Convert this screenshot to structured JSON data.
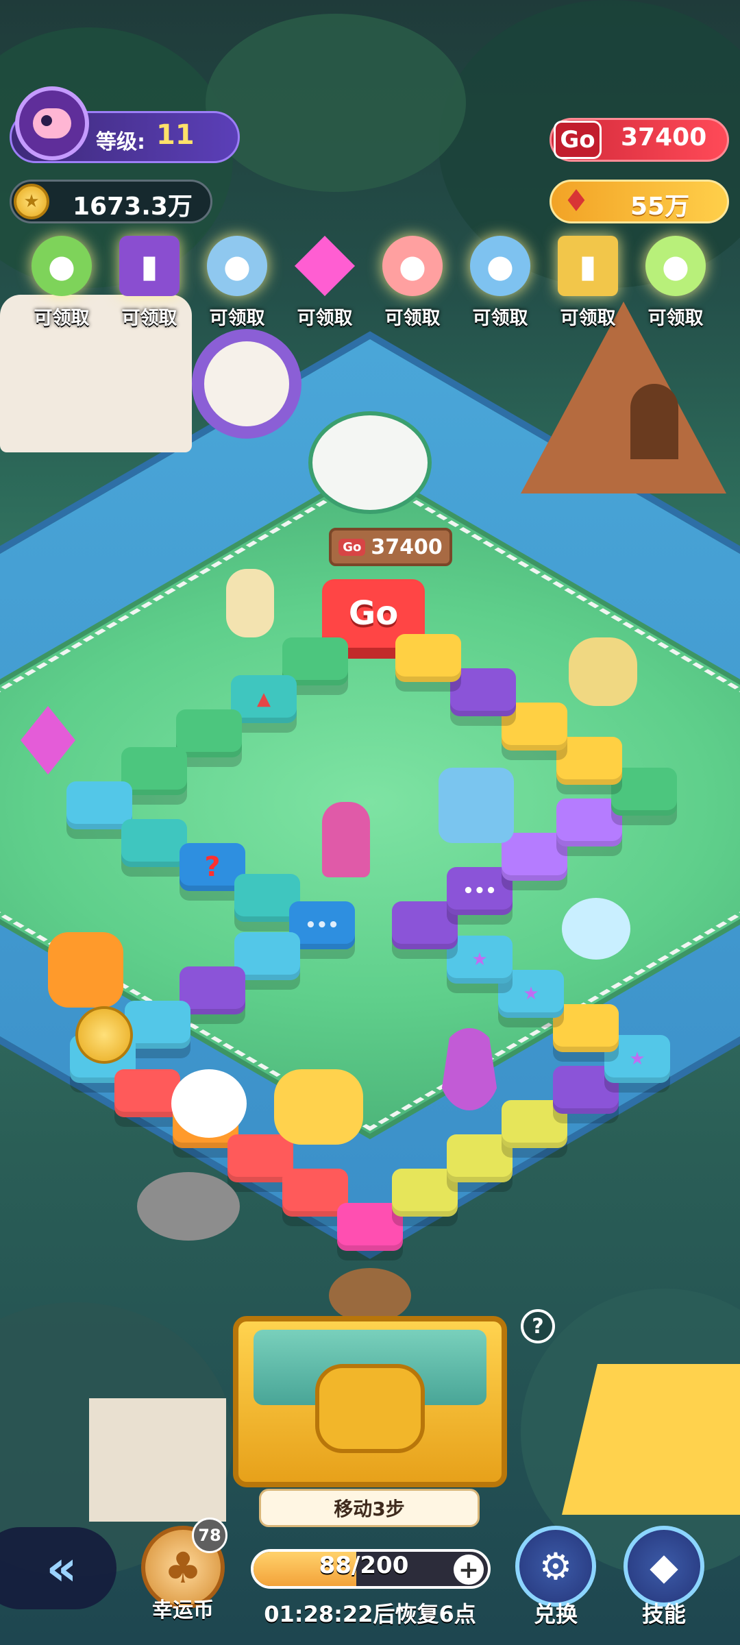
{
  "hud": {
    "level_label": "等级:",
    "level_value": "11",
    "coins": "1673.3万",
    "go_points": "37400",
    "go_badge": "Go",
    "gems": "55万"
  },
  "rewards": [
    {
      "label": "可领取",
      "icon": "green-fish-icon"
    },
    {
      "label": "可领取",
      "icon": "purple-book-icon"
    },
    {
      "label": "可领取",
      "icon": "parrot-icon"
    },
    {
      "label": "可领取",
      "icon": "pink-crystal-icon"
    },
    {
      "label": "可领取",
      "icon": "pig-icon"
    },
    {
      "label": "可领取",
      "icon": "pufferfish-icon"
    },
    {
      "label": "可领取",
      "icon": "golden-scroll-icon"
    },
    {
      "label": "可领取",
      "icon": "chick-icon"
    }
  ],
  "board": {
    "sign_badge": "Go",
    "sign_value": "37400",
    "start_label": "Go",
    "mystery_mark": "?",
    "dots_mark": "•••"
  },
  "bottom": {
    "move_label": "移动3步",
    "help": "?",
    "lucky_label": "幸运币",
    "lucky_count": "78",
    "energy": "88/200",
    "energy_fraction": 0.44,
    "energy_plus": "+",
    "timer": "01:28:22后恢复6点",
    "exchange_label": "兑换",
    "skills_label": "技能",
    "back_icon": "back-arrow-icon"
  },
  "colors": {
    "accent_red": "#ff4545",
    "level_purple": "#5b3fb8",
    "gem_gold": "#ffcf4a"
  }
}
